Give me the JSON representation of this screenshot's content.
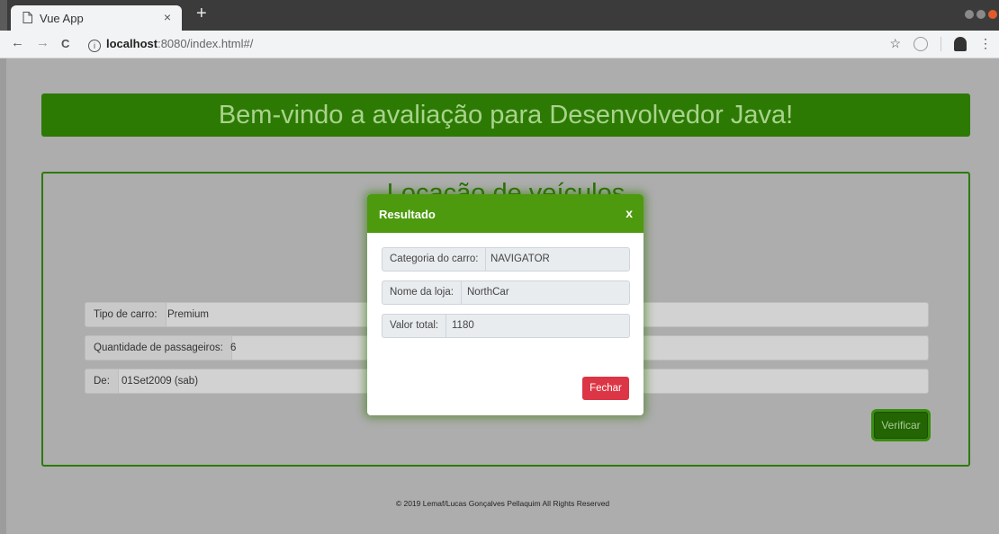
{
  "browser": {
    "tab_title": "Vue App",
    "tab_close": "×",
    "new_tab": "+",
    "url_host": "localhost",
    "url_rest": ":8080/index.html#/",
    "back": "←",
    "forward": "→",
    "reload": "C",
    "info_icon": "i",
    "bookmark": "☆",
    "menu": "⋮"
  },
  "page": {
    "banner": "Bem-vindo a avaliação para Desenvolvedor Java!",
    "card_title": "Locação de veículos",
    "form": [
      {
        "label": "Tipo de carro:",
        "value": "Premium"
      },
      {
        "label": "Quantidade de passageiros:",
        "value": "6"
      },
      {
        "label": "De:",
        "value": "01Set2009 (sab)"
      }
    ],
    "verify_button": "Verificar",
    "footer": "© 2019 Lemaf/Lucas Gonçalves Pellaquim All Rights Reserved"
  },
  "modal": {
    "title": "Resultado",
    "close_x": "x",
    "fields": [
      {
        "label": "Categoria do carro:",
        "value": "NAVIGATOR"
      },
      {
        "label": "Nome da loja:",
        "value": "NorthCar"
      },
      {
        "label": "Valor total:",
        "value": "1180"
      }
    ],
    "close_button": "Fechar"
  },
  "colors": {
    "accent_green": "#2c7a03",
    "modal_header": "#4d9a0e",
    "danger": "#dc3545"
  }
}
